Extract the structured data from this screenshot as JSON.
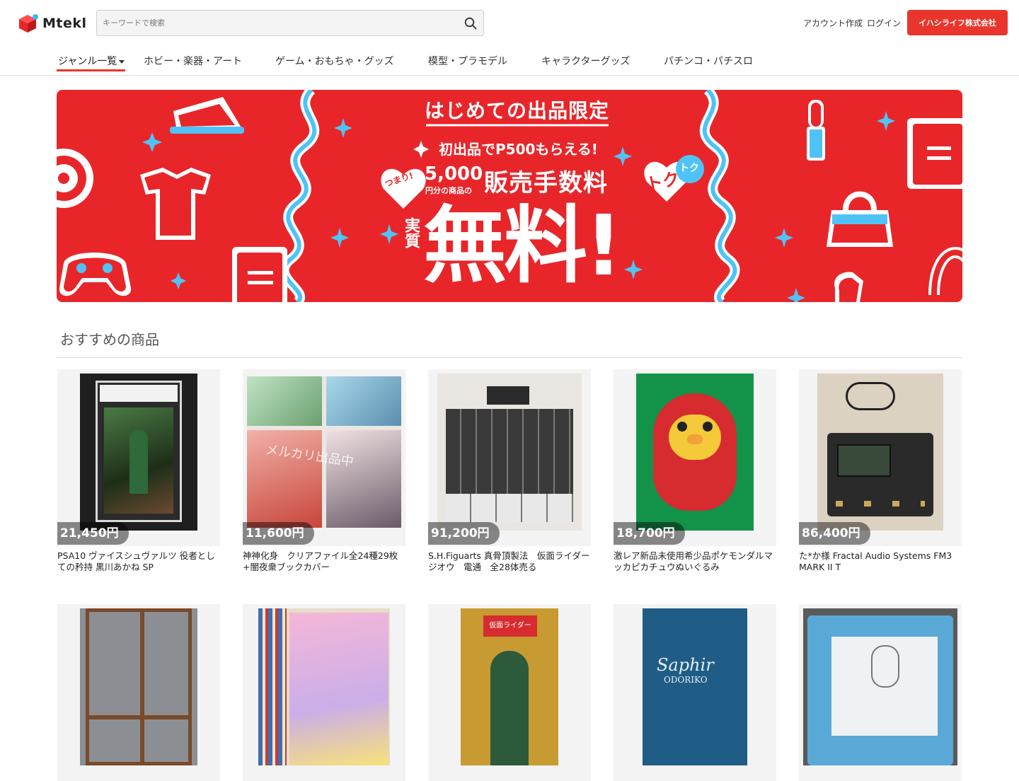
{
  "header": {
    "logo_text": "Mtekl",
    "search_placeholder": "キーワードで検索",
    "account_create": "アカウント作成",
    "login": "ログイン",
    "cta": "イハシライフ株式会社"
  },
  "nav": {
    "items": [
      {
        "label": "ジャンル一覧"
      },
      {
        "label": "ホビー・楽器・アート"
      },
      {
        "label": "ゲーム・おもちゃ・グッズ"
      },
      {
        "label": "模型・プラモデル"
      },
      {
        "label": "キャラクターグッズ"
      },
      {
        "label": "パチンコ・パチスロ"
      }
    ]
  },
  "banner": {
    "headline": "はじめての出品限定",
    "sub": "初出品でP500もらえる!",
    "tsumari": "つまり!",
    "amount": "5,000",
    "amount_note": "円分の商品の",
    "fee": "販売手数料",
    "jisshitsu": "実質",
    "free": "無料!",
    "toku": "トク",
    "toku_small": "トク"
  },
  "recommend": {
    "title": "おすすめの商品",
    "items": [
      {
        "price": "21,450円",
        "title": "PSA10 ヴァイスシュヴァルツ 役者としての矜持 黒川あかね SP"
      },
      {
        "price": "11,600円",
        "title": "神神化身　クリアファイル全24種29枚+闇夜衆ブックカバー"
      },
      {
        "price": "91,200円",
        "title": "S.H.Figuarts 真骨頂製法　仮面ライダージオウ　電通　全28体売る"
      },
      {
        "price": "18,700円",
        "title": "激レア新品未使用希少品ポケモンダルマッカピカチュウぬいぐるみ"
      },
      {
        "price": "86,400円",
        "title": "た*か様 Fractal Audio Systems FM3 MARK II T"
      },
      {
        "price": "",
        "title": ""
      },
      {
        "price": "",
        "title": ""
      },
      {
        "price": "",
        "title": ""
      },
      {
        "price": "",
        "title": ""
      },
      {
        "price": "",
        "title": ""
      }
    ]
  },
  "product_images": {
    "card_2_watermark": "メルカリ出品中",
    "card_3_label": "仮面ライダー",
    "card_4_brand": "Saphir",
    "card_4_sub": "ODORIKO"
  },
  "colors": {
    "accent": "#ea352d",
    "banner_red": "#e8262a",
    "banner_blue": "#4fc3f7"
  }
}
